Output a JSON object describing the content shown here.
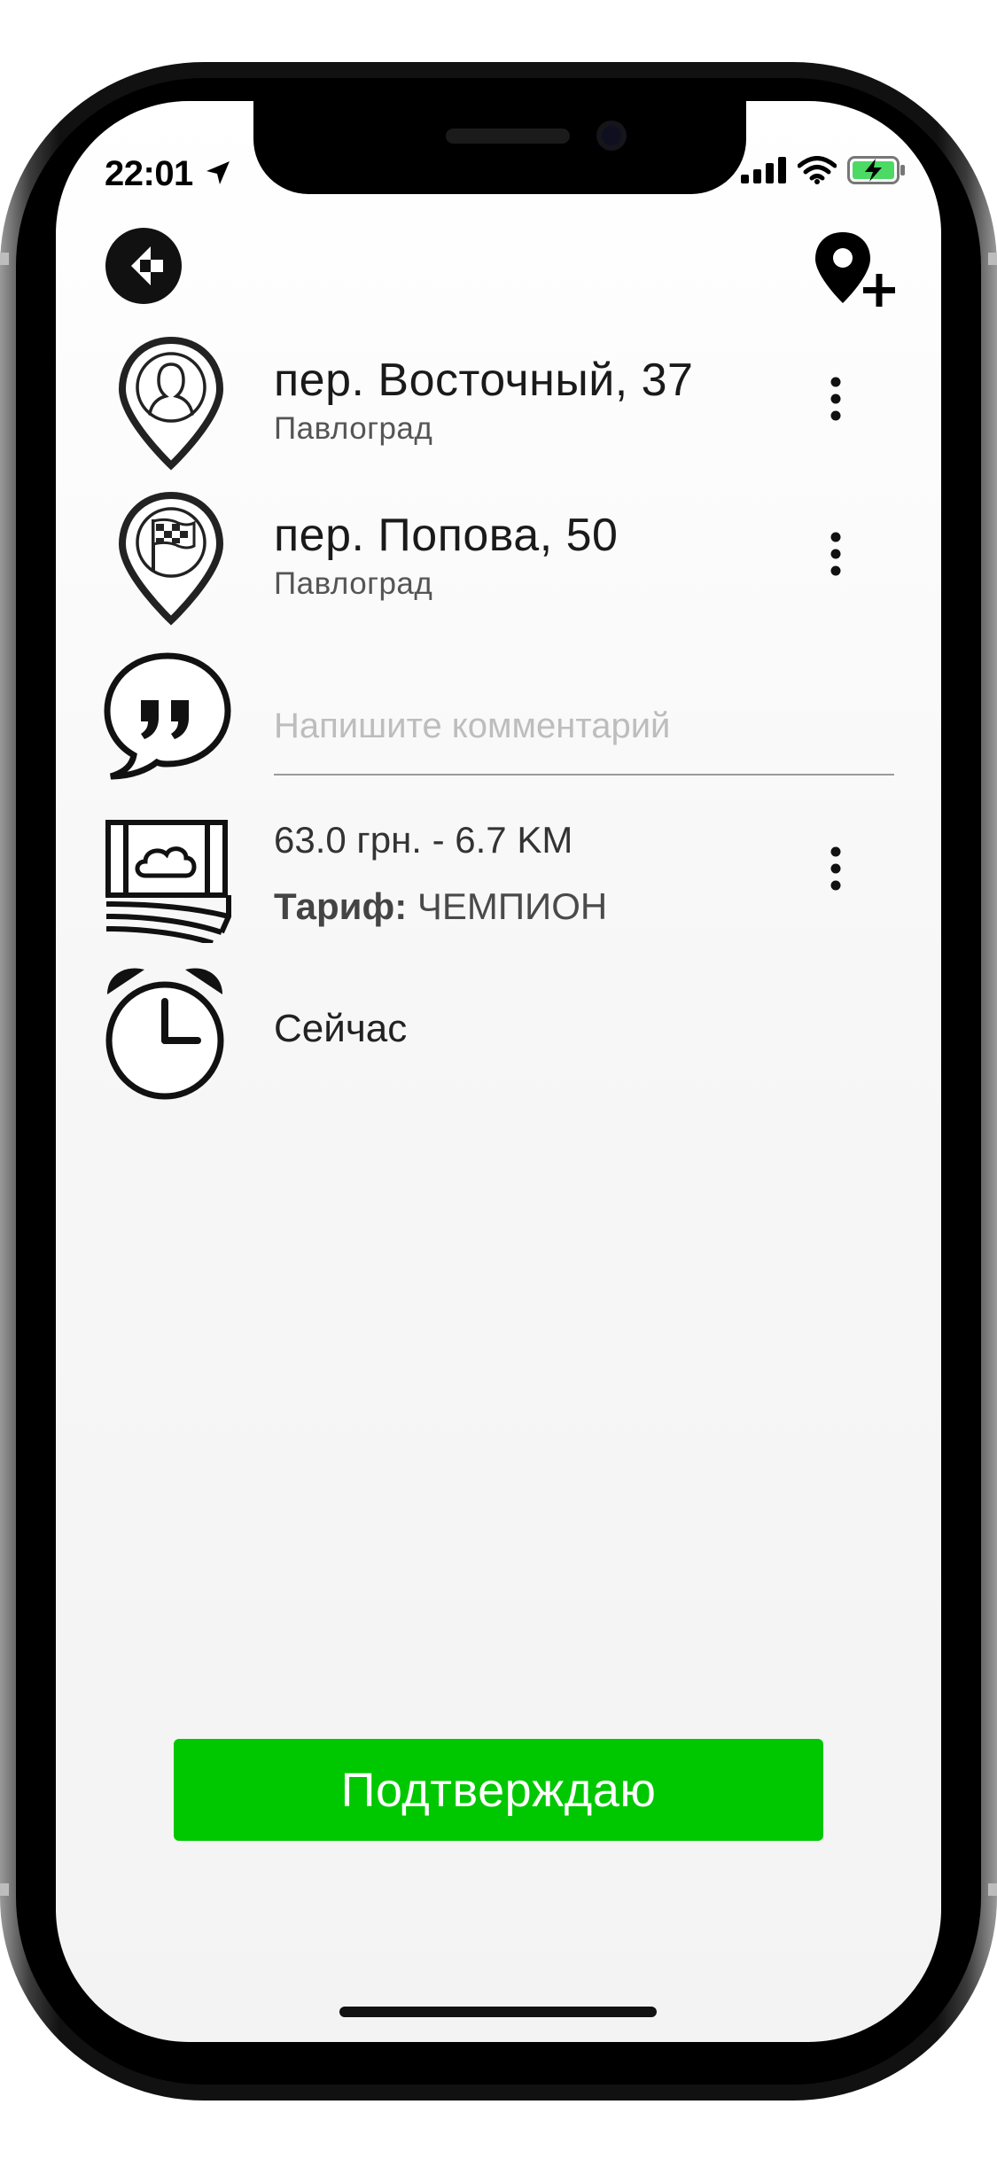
{
  "status_bar": {
    "time": "22:01"
  },
  "route": {
    "pickup": {
      "address": "пер. Восточный, 37",
      "city": "Павлоград"
    },
    "destination": {
      "address": "пер. Попова, 50",
      "city": "Павлоград"
    }
  },
  "comment": {
    "placeholder": "Напишите комментарий",
    "value": ""
  },
  "fare": {
    "price_distance": "63.0 грн. - 6.7 KM",
    "tariff_label": "Тариф:",
    "tariff_value": "ЧЕМПИОН"
  },
  "schedule": {
    "time_label": "Сейчас"
  },
  "actions": {
    "confirm_label": "Подтверждаю"
  },
  "colors": {
    "accent_green": "#00c800",
    "battery_green": "#4cd964"
  }
}
